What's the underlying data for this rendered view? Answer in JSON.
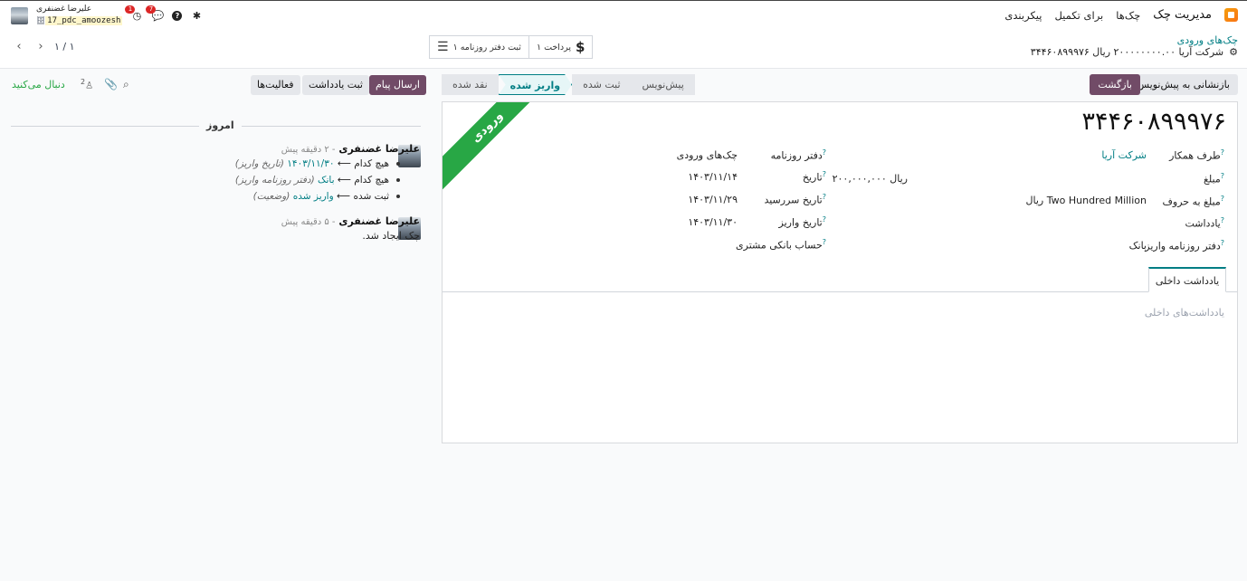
{
  "navbar": {
    "app_title": "مدیریت چک",
    "menu": [
      "چک‌ها",
      "برای تکمیل",
      "پیکربندی"
    ],
    "user_name": "علیرضا غضنفری",
    "db_name": "17_pdc_amoozesh",
    "activity_badge": "1",
    "messages_badge": "7"
  },
  "breadcrumb": {
    "parent": "چک‌های ورودی",
    "current": "۳۴۴۶۰۸۹۹۹۷۶ شرکت آریا ۲۰۰۰۰۰۰۰۰.۰۰ ریال"
  },
  "smart_buttons": {
    "payment": "۱ پرداخت",
    "journal": "۱ ثبت دفتر روزنامه"
  },
  "pager": {
    "text": "۱ / ۱"
  },
  "actions": {
    "back": "بازگشت",
    "reset_draft": "بازنشانی به پیش‌نویس"
  },
  "status_stages": [
    "پیش‌نویس",
    "ثبت شده",
    "واریز شده",
    "نقد شده"
  ],
  "status_active": "واریز شده",
  "ribbon": "ورودی",
  "record": {
    "title": "۳۴۴۶۰۸۹۹۹۷۶",
    "partner_label": "طرف همکار",
    "partner_value": "شرکت آریا",
    "amount_label": "مبلغ",
    "amount_value": "۲۰۰,۰۰۰,۰۰۰ ریال",
    "amount_words_label": "مبلغ به حروف",
    "amount_words_value": "Two Hundred Million ریال",
    "memo_label": "یادداشت",
    "deposit_journal_label": "دفتر روزنامه واریز",
    "deposit_journal_value": "بانک",
    "journal_label": "دفتر روزنامه",
    "journal_value": "چک‌های ورودی",
    "date_label": "تاریخ",
    "date_value": "۱۴۰۳/۱۱/۱۴",
    "due_label": "تاریخ سررسید",
    "due_value": "۱۴۰۳/۱۱/۲۹",
    "deposit_date_label": "تاریخ واریز",
    "deposit_date_value": "۱۴۰۳/۱۱/۳۰",
    "bank_account_label": "حساب بانکی مشتری"
  },
  "tabs": {
    "internal_note": "یادداشت داخلی",
    "notes_placeholder": "یادداشت‌های داخلی"
  },
  "chatter": {
    "send_message": "ارسال پیام",
    "log_note": "ثبت یادداشت",
    "activities": "فعالیت‌ها",
    "following": "دنبال می‌کنید",
    "followers_count": "2",
    "separator": "امروز",
    "messages": [
      {
        "author": "علیرضا غضنفری",
        "time": "- ۲ دقیقه پیش",
        "changes": [
          {
            "old": "هیچ کدام",
            "arrow": "⟵",
            "new": "۱۴۰۳/۱۱/۳۰",
            "field": "(تاریخ واریز)"
          },
          {
            "old": "هیچ کدام",
            "arrow": "⟵",
            "new": "بانک",
            "field": "(دفتر روزنامه واریز)"
          },
          {
            "old": "ثبت شده",
            "arrow": "⟵",
            "new": "واریز شده",
            "field": "(وضعیت)"
          }
        ]
      },
      {
        "author": "علیرضا غضنفری",
        "time": "- ۵ دقیقه پیش",
        "body": "چک ایجاد شد."
      }
    ]
  }
}
